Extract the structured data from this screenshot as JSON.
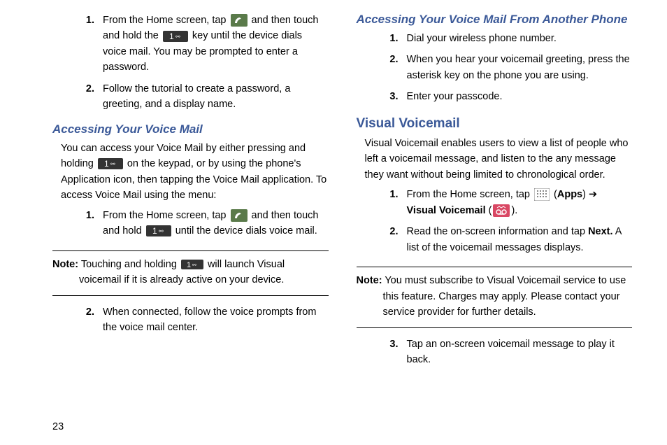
{
  "left": {
    "step1": {
      "num": "1.",
      "text_before": "From the Home screen, tap ",
      "text_mid": " and then touch and hold the ",
      "text_after": " key until the device dials voice mail. You may be prompted to enter a password."
    },
    "step2": {
      "num": "2.",
      "text": "Follow the tutorial to create a password, a greeting, and a display name."
    },
    "heading1": "Accessing Your Voice Mail",
    "para1_before": "You can access your Voice Mail by either pressing and holding ",
    "para1_after": " on the keypad, or by using the phone's Application icon, then tapping the Voice Mail application. To access Voice Mail using the menu:",
    "sub_step1": {
      "num": "1.",
      "text_before": "From the Home screen, tap ",
      "text_mid": " and then touch and hold ",
      "text_after": " until the device dials voice mail."
    },
    "note1": {
      "label": "Note:",
      "text_before": " Touching and holding ",
      "text_after": " will launch Visual voicemail if it is already active on your device."
    },
    "sub_step2": {
      "num": "2.",
      "text": "When connected, follow the voice prompts from the voice mail center."
    },
    "page_num": "23"
  },
  "right": {
    "heading1": "Accessing Your Voice Mail From Another Phone",
    "step1": {
      "num": "1.",
      "text": "Dial your wireless phone number."
    },
    "step2": {
      "num": "2.",
      "text": "When you hear your voicemail greeting, press the asterisk key on the phone you are using."
    },
    "step3": {
      "num": "3.",
      "text": "Enter your passcode."
    },
    "heading2": "Visual Voicemail",
    "para1": "Visual Voicemail enables users to view a list of people who left a voicemail message, and listen to the any message they want without being limited to chronological order.",
    "vstep1": {
      "num": "1.",
      "text_before": "From the Home screen, tap ",
      "apps": "Apps",
      "arrow": " ➔ ",
      "vv": "Visual Voicemail",
      "paren_open": " (",
      "paren_close": ")."
    },
    "vstep2": {
      "num": "2.",
      "text_before": "Read the on-screen information and tap ",
      "next": "Next.",
      "text_after": " A list of the voicemail messages displays."
    },
    "note1": {
      "label": "Note:",
      "text": " You must subscribe to Visual Voicemail service to use this feature. Charges may apply. Please contact your service provider for further details."
    },
    "vstep3": {
      "num": "3.",
      "text": "Tap an on-screen voicemail message to play it back."
    }
  }
}
